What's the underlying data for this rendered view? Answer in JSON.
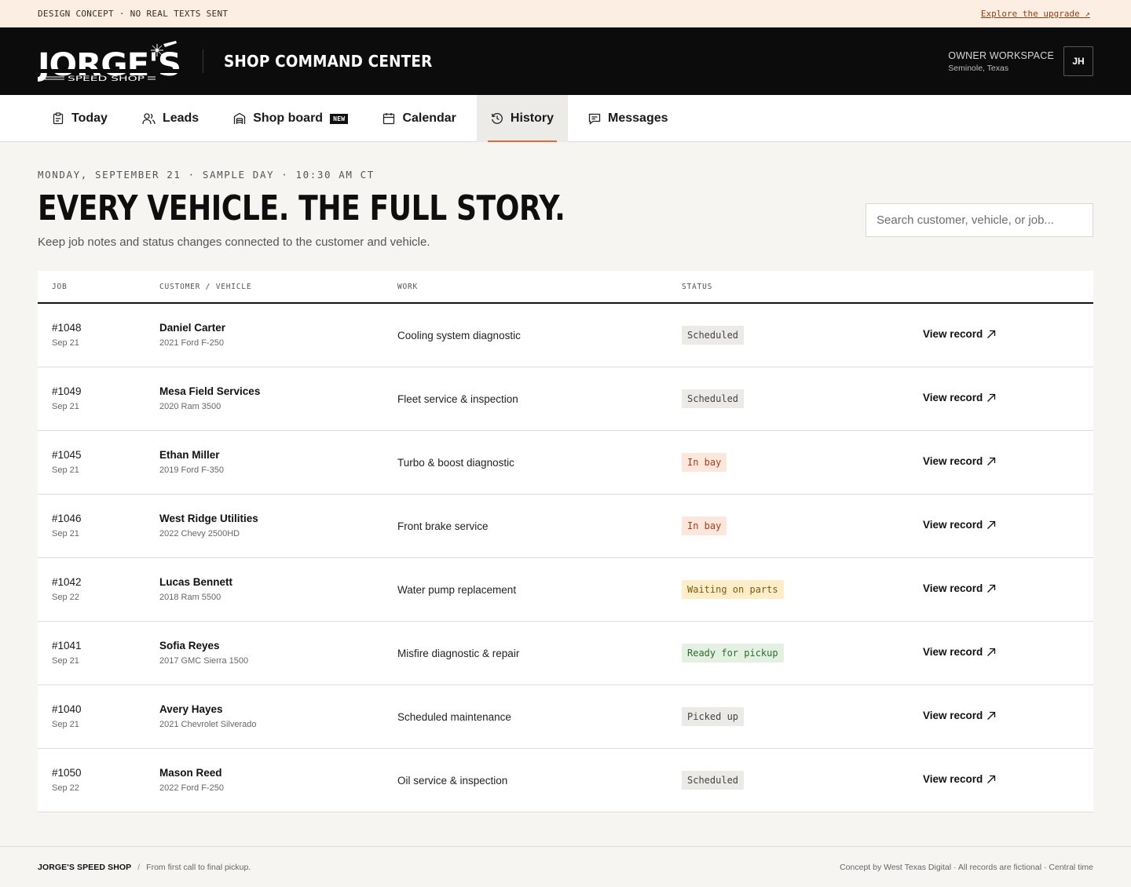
{
  "banner": {
    "text": "DESIGN CONCEPT · NO REAL TEXTS SENT",
    "link": "Explore the upgrade ↗"
  },
  "header": {
    "logo_main": "JORGE'S",
    "logo_sub": "SPEED SHOP",
    "title": "SHOP COMMAND CENTER",
    "workspace_label": "OWNER WORKSPACE",
    "workspace_location": "Seminole, Texas",
    "avatar_initials": "JH"
  },
  "nav": {
    "today": "Today",
    "leads": "Leads",
    "shop_board": "Shop board",
    "shop_board_badge": "NEW",
    "calendar": "Calendar",
    "history": "History",
    "messages": "Messages",
    "active": "history"
  },
  "page": {
    "date_line": "MONDAY, SEPTEMBER 21 · SAMPLE DAY · 10:30 AM CT",
    "title": "EVERY VEHICLE. THE FULL STORY.",
    "subtitle": "Keep job notes and status changes connected to the customer and vehicle.",
    "search_placeholder": "Search customer, vehicle, or job..."
  },
  "table": {
    "headers": {
      "job": "JOB",
      "customer": "CUSTOMER / VEHICLE",
      "work": "WORK",
      "status": "STATUS"
    },
    "action_label": "View record",
    "rows": [
      {
        "job": "#1048",
        "date": "Sep 21",
        "customer": "Daniel Carter",
        "vehicle": "2021 Ford F-250",
        "work": "Cooling system diagnostic",
        "status": "Scheduled",
        "status_kind": "scheduled"
      },
      {
        "job": "#1049",
        "date": "Sep 21",
        "customer": "Mesa Field Services",
        "vehicle": "2020 Ram 3500",
        "work": "Fleet service & inspection",
        "status": "Scheduled",
        "status_kind": "scheduled"
      },
      {
        "job": "#1045",
        "date": "Sep 21",
        "customer": "Ethan Miller",
        "vehicle": "2019 Ford F-350",
        "work": "Turbo & boost diagnostic",
        "status": "In bay",
        "status_kind": "inbay"
      },
      {
        "job": "#1046",
        "date": "Sep 21",
        "customer": "West Ridge Utilities",
        "vehicle": "2022 Chevy 2500HD",
        "work": "Front brake service",
        "status": "In bay",
        "status_kind": "inbay"
      },
      {
        "job": "#1042",
        "date": "Sep 22",
        "customer": "Lucas Bennett",
        "vehicle": "2018 Ram 5500",
        "work": "Water pump replacement",
        "status": "Waiting on parts",
        "status_kind": "waiting"
      },
      {
        "job": "#1041",
        "date": "Sep 21",
        "customer": "Sofia Reyes",
        "vehicle": "2017 GMC Sierra 1500",
        "work": "Misfire diagnostic & repair",
        "status": "Ready for pickup",
        "status_kind": "ready"
      },
      {
        "job": "#1040",
        "date": "Sep 21",
        "customer": "Avery Hayes",
        "vehicle": "2021 Chevrolet Silverado",
        "work": "Scheduled maintenance",
        "status": "Picked up",
        "status_kind": "picked"
      },
      {
        "job": "#1050",
        "date": "Sep 22",
        "customer": "Mason Reed",
        "vehicle": "2022 Ford F-250",
        "work": "Oil service & inspection",
        "status": "Scheduled",
        "status_kind": "scheduled"
      }
    ]
  },
  "footer": {
    "brand": "JORGE'S SPEED SHOP",
    "separator": "/",
    "tagline": "From first call to final pickup.",
    "right": "Concept by West Texas Digital · All records are fictional · Central time"
  },
  "colors": {
    "accent": "#e06a3a",
    "header_bg": "#0c0c0c",
    "banner_bg": "#fdeee3",
    "page_bg": "#f6f5f1"
  }
}
